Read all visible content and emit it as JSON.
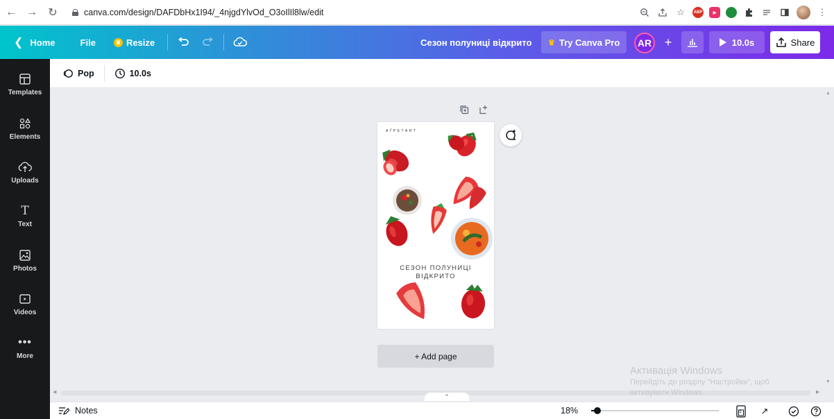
{
  "browser": {
    "url": "canva.com/design/DAFDbHx1I94/_4njgdYlvOd_O3oIlIl8lw/edit",
    "extensions": [
      "zoom-icon",
      "share-icon",
      "star-icon",
      "adblock-icon",
      "video-ext-icon",
      "green-ext-icon",
      "puzzle-icon",
      "reading-list-icon",
      "side-panel-icon",
      "profile-avatar",
      "menu-icon"
    ]
  },
  "topbar": {
    "home": "Home",
    "file": "File",
    "resize": "Resize",
    "design_title": "Сезон полуниці відкрито",
    "try_pro": "Try Canva Pro",
    "user_initials": "AR",
    "play_duration": "10.0s",
    "share": "Share",
    "accent_gradient": [
      "#00c4cc",
      "#7d2ae8"
    ]
  },
  "sidebar": {
    "items": [
      {
        "label": "Templates",
        "icon": "templates-icon"
      },
      {
        "label": "Elements",
        "icon": "elements-icon"
      },
      {
        "label": "Uploads",
        "icon": "uploads-icon"
      },
      {
        "label": "Text",
        "icon": "text-icon"
      },
      {
        "label": "Photos",
        "icon": "photos-icon"
      },
      {
        "label": "Videos",
        "icon": "videos-icon"
      },
      {
        "label": "More",
        "icon": "more-icon"
      }
    ]
  },
  "toolbar": {
    "animation": "Pop",
    "duration": "10.0s"
  },
  "design": {
    "brand": "АҐРЕТАНТ",
    "caption_line1": "СЕЗОН ПОЛУНИЦІ",
    "caption_line2": "ВІДКРИТО"
  },
  "canvas": {
    "add_page": "+ Add page"
  },
  "footer": {
    "notes": "Notes",
    "zoom": "18%",
    "zoom_value": 0.05,
    "page_count": "1"
  },
  "watermark": {
    "line1": "Активація Windows",
    "line2": "Перейдіть до розділу \"Настройки\", щоб",
    "line3": "активувати Windows."
  }
}
